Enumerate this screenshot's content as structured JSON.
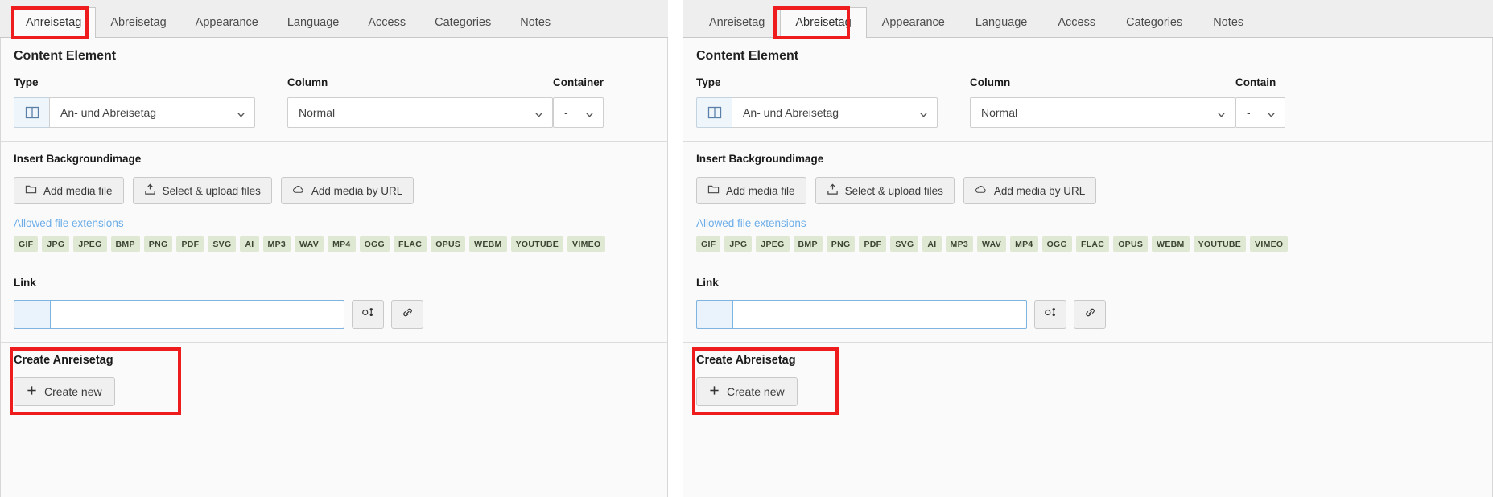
{
  "panels": [
    {
      "id": "left",
      "tabs": [
        {
          "label": "Anreisetag",
          "active": true
        },
        {
          "label": "Abreisetag",
          "active": false
        },
        {
          "label": "Appearance",
          "active": false
        },
        {
          "label": "Language",
          "active": false
        },
        {
          "label": "Access",
          "active": false
        },
        {
          "label": "Categories",
          "active": false
        },
        {
          "label": "Notes",
          "active": false
        }
      ],
      "content_element": {
        "title": "Content Element",
        "type_label": "Type",
        "type_value": "An- und Abreisetag",
        "column_label": "Column",
        "column_value": "Normal",
        "container_label": "Container",
        "container_value": "-"
      },
      "background_image": {
        "title": "Insert Backgroundimage",
        "buttons": [
          {
            "label": "Add media file",
            "icon": "folder-icon"
          },
          {
            "label": "Select & upload files",
            "icon": "upload-icon"
          },
          {
            "label": "Add media by URL",
            "icon": "cloud-icon"
          }
        ],
        "allowed_label": "Allowed file extensions",
        "extensions": [
          "GIF",
          "JPG",
          "JPEG",
          "BMP",
          "PNG",
          "PDF",
          "SVG",
          "AI",
          "MP3",
          "WAV",
          "MP4",
          "OGG",
          "FLAC",
          "OPUS",
          "WEBM",
          "YOUTUBE",
          "VIMEO"
        ]
      },
      "link": {
        "title": "Link",
        "value": "",
        "placeholder": "",
        "browse_icon": "link-browse-icon",
        "chain_icon": "chain-link-icon"
      },
      "create": {
        "title": "Create Anreisetag",
        "button_label": "Create new",
        "button_icon": "plus-icon"
      }
    },
    {
      "id": "right",
      "tabs": [
        {
          "label": "Anreisetag",
          "active": false
        },
        {
          "label": "Abreisetag",
          "active": true
        },
        {
          "label": "Appearance",
          "active": false
        },
        {
          "label": "Language",
          "active": false
        },
        {
          "label": "Access",
          "active": false
        },
        {
          "label": "Categories",
          "active": false
        },
        {
          "label": "Notes",
          "active": false
        }
      ],
      "content_element": {
        "title": "Content Element",
        "type_label": "Type",
        "type_value": "An- und Abreisetag",
        "column_label": "Column",
        "column_value": "Normal",
        "container_label": "Contain",
        "container_value": "-"
      },
      "background_image": {
        "title": "Insert Backgroundimage",
        "buttons": [
          {
            "label": "Add media file",
            "icon": "folder-icon"
          },
          {
            "label": "Select & upload files",
            "icon": "upload-icon"
          },
          {
            "label": "Add media by URL",
            "icon": "cloud-icon"
          }
        ],
        "allowed_label": "Allowed file extensions",
        "extensions": [
          "GIF",
          "JPG",
          "JPEG",
          "BMP",
          "PNG",
          "PDF",
          "SVG",
          "AI",
          "MP3",
          "WAV",
          "MP4",
          "OGG",
          "FLAC",
          "OPUS",
          "WEBM",
          "YOUTUBE",
          "VIMEO"
        ]
      },
      "link": {
        "title": "Link",
        "value": "",
        "placeholder": "",
        "browse_icon": "link-browse-icon",
        "chain_icon": "chain-link-icon"
      },
      "create": {
        "title": "Create Abreisetag",
        "button_label": "Create new",
        "button_icon": "plus-icon"
      }
    }
  ],
  "annotations": {
    "highlight_color": "#ee1c1c",
    "boxes": [
      {
        "target": "left-tab-anreisetag"
      },
      {
        "target": "left-create-anreisetag-section"
      },
      {
        "target": "right-tab-abreisetag"
      },
      {
        "target": "right-create-abreisetag-section"
      }
    ]
  }
}
